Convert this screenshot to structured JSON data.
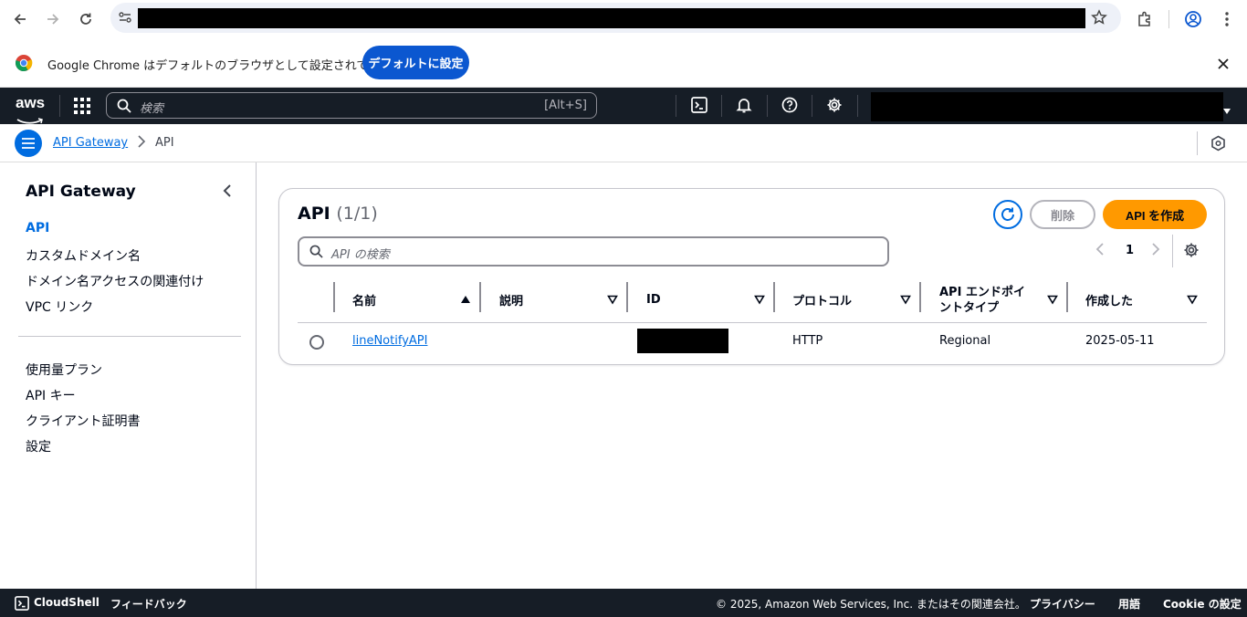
{
  "browser": {
    "url_redacted": true,
    "infobar_message": "Google Chrome はデフォルトのブラウザとして設定されていません",
    "infobar_button": "デフォルトに設定"
  },
  "aws_nav": {
    "logo_text": "aws",
    "search_placeholder": "検索",
    "search_shortcut": "[Alt+S]"
  },
  "breadcrumb": {
    "items": [
      {
        "label": "API Gateway"
      },
      {
        "label": "API"
      }
    ]
  },
  "sidebar": {
    "title": "API Gateway",
    "group1": [
      {
        "label": "API",
        "active": true
      },
      {
        "label": "カスタムドメイン名"
      },
      {
        "label": "ドメイン名アクセスの関連付け"
      },
      {
        "label": "VPC リンク"
      }
    ],
    "group2": [
      {
        "label": "使用量プラン"
      },
      {
        "label": "API キー"
      },
      {
        "label": "クライアント証明書"
      },
      {
        "label": "設定"
      }
    ]
  },
  "main": {
    "title": "API",
    "count": "(1/1)",
    "delete_label": "削除",
    "create_label": "API を作成",
    "filter_placeholder": "API の検索",
    "page": "1",
    "columns": [
      "名前",
      "説明",
      "ID",
      "プロトコル",
      "API エンドポイントタイプ",
      "作成した"
    ],
    "columns_split": {
      "endpoint_line1": "API エンドポイ",
      "endpoint_line2": "ントタイプ"
    },
    "rows": [
      {
        "name": "lineNotifyAPI",
        "description": "",
        "id_redacted": true,
        "protocol": "HTTP",
        "endpoint_type": "Regional",
        "created": "2025-05-11"
      }
    ]
  },
  "footer": {
    "cloudshell": "CloudShell",
    "feedback": "フィードバック",
    "copyright": "© 2025, Amazon Web Services, Inc. またはその関連会社。",
    "privacy": "プライバシー",
    "terms": "用語",
    "cookie": "Cookie の設定"
  },
  "colors": {
    "aws_nav_bg": "#161d26",
    "link_blue": "#006ce0",
    "primary_orange": "#ff9900",
    "chrome_blue": "#0b57d0"
  }
}
